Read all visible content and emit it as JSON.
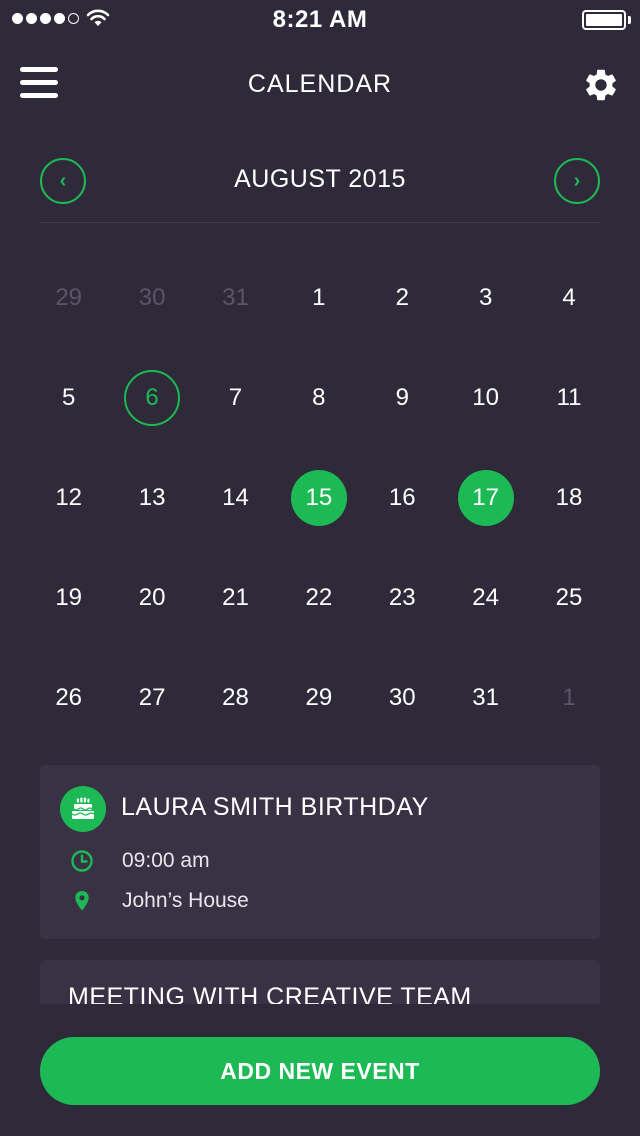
{
  "status_bar": {
    "time": "8:21 AM",
    "signal_bars": 4,
    "signal_icon": "signal-dots-icon",
    "wifi_icon": "wifi-icon",
    "battery_icon": "battery-icon",
    "battery_level": 1.0
  },
  "nav": {
    "title": "CALENDAR",
    "menu_icon": "hamburger-menu-icon",
    "settings_icon": "gear-icon"
  },
  "month": {
    "title": "AUGUST 2015",
    "prev_icon": "chevron-left-icon",
    "next_icon": "chevron-right-icon",
    "prev_glyph": "‹",
    "next_glyph": "›"
  },
  "calendar": {
    "days": [
      {
        "label": "29",
        "state": "muted"
      },
      {
        "label": "30",
        "state": "muted"
      },
      {
        "label": "31",
        "state": "muted"
      },
      {
        "label": "1",
        "state": "normal"
      },
      {
        "label": "2",
        "state": "normal"
      },
      {
        "label": "3",
        "state": "normal"
      },
      {
        "label": "4",
        "state": "normal"
      },
      {
        "label": "5",
        "state": "normal"
      },
      {
        "label": "6",
        "state": "today"
      },
      {
        "label": "7",
        "state": "normal"
      },
      {
        "label": "8",
        "state": "normal"
      },
      {
        "label": "9",
        "state": "normal"
      },
      {
        "label": "10",
        "state": "normal"
      },
      {
        "label": "11",
        "state": "normal"
      },
      {
        "label": "12",
        "state": "normal"
      },
      {
        "label": "13",
        "state": "normal"
      },
      {
        "label": "14",
        "state": "normal"
      },
      {
        "label": "15",
        "state": "selected"
      },
      {
        "label": "16",
        "state": "normal"
      },
      {
        "label": "17",
        "state": "selected"
      },
      {
        "label": "18",
        "state": "normal"
      },
      {
        "label": "19",
        "state": "normal"
      },
      {
        "label": "20",
        "state": "normal"
      },
      {
        "label": "21",
        "state": "normal"
      },
      {
        "label": "22",
        "state": "normal"
      },
      {
        "label": "23",
        "state": "normal"
      },
      {
        "label": "24",
        "state": "normal"
      },
      {
        "label": "25",
        "state": "normal"
      },
      {
        "label": "26",
        "state": "normal"
      },
      {
        "label": "27",
        "state": "normal"
      },
      {
        "label": "28",
        "state": "normal"
      },
      {
        "label": "29",
        "state": "normal"
      },
      {
        "label": "30",
        "state": "normal"
      },
      {
        "label": "31",
        "state": "normal"
      },
      {
        "label": "1",
        "state": "muted"
      }
    ]
  },
  "events": [
    {
      "title": "LAURA SMITH BIRTHDAY",
      "icon": "birthday-cake-icon",
      "time": "09:00 am",
      "time_icon": "clock-icon",
      "location": "John’s House",
      "location_icon": "map-pin-icon"
    },
    {
      "title": "MEETING WITH CREATIVE TEAM"
    }
  ],
  "add_button": {
    "label": "ADD NEW EVENT"
  },
  "colors": {
    "background": "#2f2a3a",
    "card": "#383244",
    "accent": "#1db954",
    "muted_text": "#5b5567"
  }
}
